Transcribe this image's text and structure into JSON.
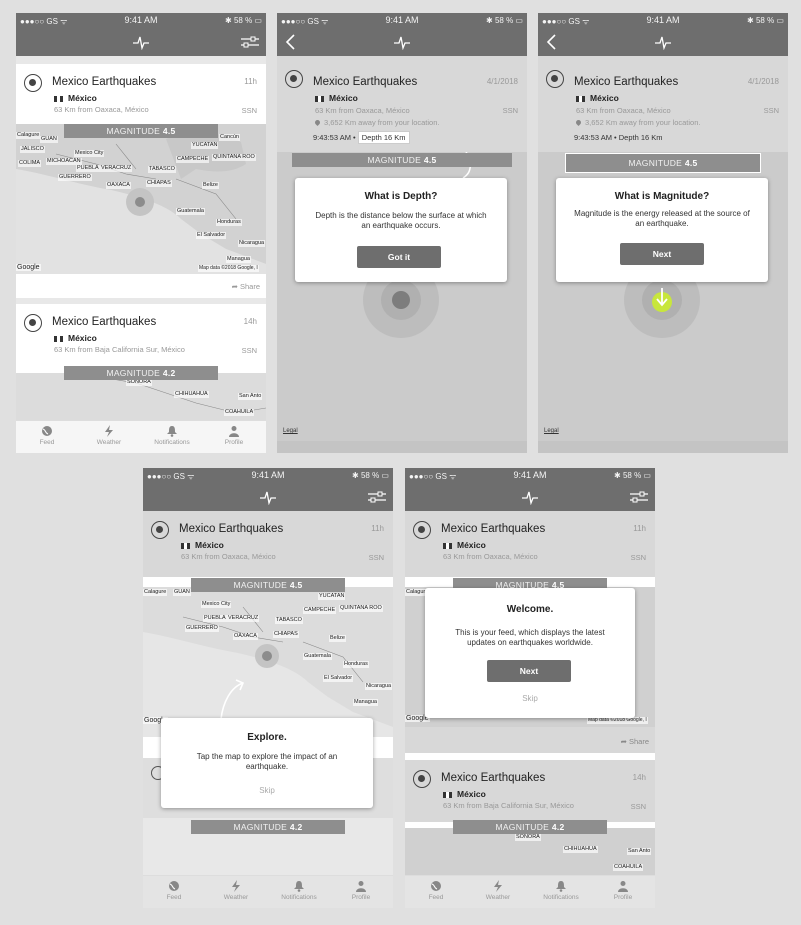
{
  "status": {
    "carrier": "●●●○○ GS ᯤ",
    "time": "9:41 AM",
    "battery": "✱ 58 % ▭"
  },
  "card1": {
    "title": "Mexico Earthquakes",
    "ago": "11h",
    "country": "México",
    "distance": "63 Km from Oaxaca, México",
    "source": "SSN",
    "magnitude_label": "MAGNITUDE",
    "magnitude": "4.5",
    "share": "Share"
  },
  "card2": {
    "title": "Mexico Earthquakes",
    "ago": "14h",
    "country": "México",
    "distance": "63 Km from Baja California Sur, México",
    "source": "SSN",
    "magnitude_label": "MAGNITUDE",
    "magnitude": "4.2"
  },
  "detail": {
    "title": "Mexico Earthquakes",
    "date": "4/1/2018",
    "country": "México",
    "distance": "63 Km from Oaxaca, México",
    "source": "SSN",
    "away": "3,652 Km away from your location.",
    "time": "9:43:53 AM",
    "depth": "Depth 16 Km",
    "magnitude_label": "MAGNITUDE",
    "magnitude": "4.5",
    "legal": "Legal"
  },
  "map_labels": {
    "calagure": "Calagure",
    "guan": "GUAN",
    "jalisco": "JALISCO",
    "mexico_city": "Mexico City",
    "colima": "COLIMA",
    "michoacan": "MICHOACAN",
    "puebla": "PUEBLA",
    "veracruz": "VERACRUZ",
    "tabasco": "TABASCO",
    "campeche": "CAMPECHE",
    "quintana": "QUINTANA ROO",
    "yucatan": "YUCATAN",
    "guerrero": "GUERRERO",
    "oaxaca": "OAXACA",
    "chiapas": "CHIAPAS",
    "belize": "Belize",
    "guatemala": "Guatemala",
    "honduras": "Honduras",
    "el_salvador": "El Salvador",
    "nicaragua": "Nicaragua",
    "managua": "Managua",
    "cancun": "Cancún",
    "google": "Google",
    "mapdata": "Map data ©2018 Google, I",
    "sonora": "SONORA",
    "chihuahua": "CHIHUAHUA",
    "coahuila": "COAHUILA",
    "san_antonio": "San Anto"
  },
  "tabs": {
    "feed": "Feed",
    "weather": "Weather",
    "notifications": "Notifications",
    "profile": "Profile"
  },
  "dialog_depth": {
    "title": "What is Depth?",
    "text": "Depth is the distance below the surface at which an earthquake occurs.",
    "button": "Got it"
  },
  "dialog_magnitude": {
    "title": "What is Magnitude?",
    "text": "Magnitude is the energy released at the source of an earthquake.",
    "button": "Next"
  },
  "dialog_explore": {
    "title": "Explore.",
    "text": "Tap the map to explore the impact of an earthquake.",
    "skip": "Skip"
  },
  "dialog_welcome": {
    "title": "Welcome.",
    "text": "This is your feed, which displays the latest updates on earthquakes worldwide.",
    "button": "Next",
    "skip": "Skip"
  },
  "colors": {
    "bar": "#6e6e6e",
    "magnitude_bar": "#8e8e8e",
    "accent": "#c8e63c"
  }
}
